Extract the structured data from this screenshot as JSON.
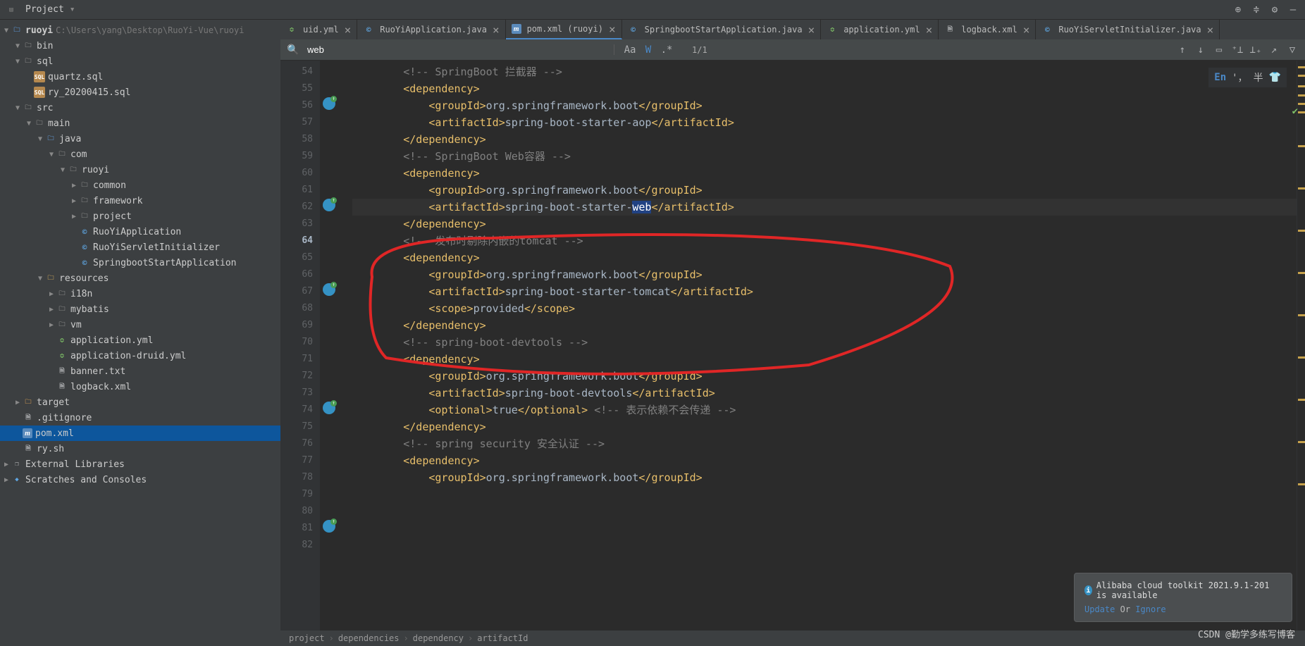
{
  "toolbar": {
    "project_label": "Project"
  },
  "tree": {
    "root": {
      "name": "ruoyi",
      "path": "C:\\Users\\yang\\Desktop\\RuoYi-Vue\\ruoyi"
    },
    "items": [
      {
        "d": 1,
        "tw": "▼",
        "ic": "dir",
        "l": "bin"
      },
      {
        "d": 1,
        "tw": "▼",
        "ic": "dir",
        "l": "sql"
      },
      {
        "d": 2,
        "tw": "",
        "ic": "sql",
        "l": "quartz.sql"
      },
      {
        "d": 2,
        "tw": "",
        "ic": "sql",
        "l": "ry_20200415.sql"
      },
      {
        "d": 1,
        "tw": "▼",
        "ic": "dir",
        "l": "src"
      },
      {
        "d": 2,
        "tw": "▼",
        "ic": "dir",
        "l": "main"
      },
      {
        "d": 3,
        "tw": "▼",
        "ic": "dir-src",
        "l": "java"
      },
      {
        "d": 4,
        "tw": "▼",
        "ic": "dir",
        "l": "com"
      },
      {
        "d": 5,
        "tw": "▼",
        "ic": "dir",
        "l": "ruoyi"
      },
      {
        "d": 6,
        "tw": "▶",
        "ic": "dir",
        "l": "common"
      },
      {
        "d": 6,
        "tw": "▶",
        "ic": "dir",
        "l": "framework"
      },
      {
        "d": 6,
        "tw": "▶",
        "ic": "dir",
        "l": "project"
      },
      {
        "d": 6,
        "tw": "",
        "ic": "java",
        "l": "RuoYiApplication"
      },
      {
        "d": 6,
        "tw": "",
        "ic": "java",
        "l": "RuoYiServletInitializer"
      },
      {
        "d": 6,
        "tw": "",
        "ic": "java",
        "l": "SpringbootStartApplication"
      },
      {
        "d": 3,
        "tw": "▼",
        "ic": "dir-res",
        "l": "resources"
      },
      {
        "d": 4,
        "tw": "▶",
        "ic": "dir",
        "l": "i18n"
      },
      {
        "d": 4,
        "tw": "▶",
        "ic": "dir",
        "l": "mybatis"
      },
      {
        "d": 4,
        "tw": "▶",
        "ic": "dir",
        "l": "vm"
      },
      {
        "d": 4,
        "tw": "",
        "ic": "yml",
        "l": "application.yml"
      },
      {
        "d": 4,
        "tw": "",
        "ic": "yml",
        "l": "application-druid.yml"
      },
      {
        "d": 4,
        "tw": "",
        "ic": "file",
        "l": "banner.txt"
      },
      {
        "d": 4,
        "tw": "",
        "ic": "file",
        "l": "logback.xml"
      },
      {
        "d": 1,
        "tw": "▶",
        "ic": "dir-exc",
        "l": "target"
      },
      {
        "d": 1,
        "tw": "",
        "ic": "file",
        "l": ".gitignore"
      },
      {
        "d": 1,
        "tw": "",
        "ic": "m",
        "l": "pom.xml",
        "sel": true
      },
      {
        "d": 1,
        "tw": "",
        "ic": "file",
        "l": "ry.sh"
      }
    ],
    "ext1": "External Libraries",
    "ext2": "Scratches and Consoles"
  },
  "tabs": [
    {
      "ic": "yml",
      "l": "uid.yml",
      "cut": true
    },
    {
      "ic": "java",
      "l": "RuoYiApplication.java"
    },
    {
      "ic": "m",
      "l": "pom.xml (ruoyi)",
      "active": true
    },
    {
      "ic": "java",
      "l": "SpringbootStartApplication.java"
    },
    {
      "ic": "yml",
      "l": "application.yml"
    },
    {
      "ic": "file",
      "l": "logback.xml"
    },
    {
      "ic": "java",
      "l": "RuoYiServletInitializer.java"
    }
  ],
  "search": {
    "value": "web",
    "count": "1/1",
    "aa": "Aa",
    "w": "W",
    "re": ".*"
  },
  "code": {
    "first_line": 54,
    "lines": [
      {
        "n": 54,
        "t": ""
      },
      {
        "n": 55,
        "t": "        <!-- SpringBoot 拦截器 -->",
        "cls": "com"
      },
      {
        "n": 56,
        "t": "        <dependency>",
        "cls": "tag",
        "mark": true
      },
      {
        "n": 57,
        "t": "            <groupId>org.springframework.boot</groupId>",
        "cls": "tag"
      },
      {
        "n": 58,
        "t": "            <artifactId>spring-boot-starter-aop</artifactId>",
        "cls": "tag"
      },
      {
        "n": 59,
        "t": "        </dependency>",
        "cls": "tag"
      },
      {
        "n": 60,
        "t": ""
      },
      {
        "n": 61,
        "t": "        <!-- SpringBoot Web容器 -->",
        "cls": "com"
      },
      {
        "n": 62,
        "t": "        <dependency>",
        "cls": "tag",
        "mark": true
      },
      {
        "n": 63,
        "t": "            <groupId>org.springframework.boot</groupId>",
        "cls": "tag"
      },
      {
        "n": 64,
        "t": "            <artifactId>spring-boot-starter-",
        "cls": "tag",
        "curr": true,
        "selword": "web",
        "after": "</artifactId>"
      },
      {
        "n": 65,
        "t": "        </dependency>",
        "cls": "tag"
      },
      {
        "n": 66,
        "t": "        <!-- 发布时剔除内嵌的tomcat -->",
        "cls": "com"
      },
      {
        "n": 67,
        "t": "        <dependency>",
        "cls": "tag",
        "mark": true
      },
      {
        "n": 68,
        "t": "            <groupId>org.springframework.boot</groupId>",
        "cls": "tag"
      },
      {
        "n": 69,
        "t": "            <artifactId>spring-boot-starter-tomcat</artifactId>",
        "cls": "tag"
      },
      {
        "n": 70,
        "t": "            <scope>provided</scope>",
        "cls": "tag"
      },
      {
        "n": 71,
        "t": "        </dependency>",
        "cls": "tag"
      },
      {
        "n": 72,
        "t": ""
      },
      {
        "n": 73,
        "t": "        <!-- spring-boot-devtools -->",
        "cls": "com"
      },
      {
        "n": 74,
        "t": "        <dependency>",
        "cls": "tag",
        "mark": true
      },
      {
        "n": 75,
        "t": "            <groupId>org.springframework.boot</groupId>",
        "cls": "tag"
      },
      {
        "n": 76,
        "t": "            <artifactId>spring-boot-devtools</artifactId>",
        "cls": "tag"
      },
      {
        "n": 77,
        "t": "            <optional>true</optional> ",
        "cls": "tag",
        "inline_com": "<!-- 表示依赖不会传递 -->"
      },
      {
        "n": 78,
        "t": "        </dependency>",
        "cls": "tag"
      },
      {
        "n": 79,
        "t": ""
      },
      {
        "n": 80,
        "t": "        <!-- spring security 安全认证 -->",
        "cls": "com"
      },
      {
        "n": 81,
        "t": "        <dependency>",
        "cls": "tag",
        "mark": true
      },
      {
        "n": 82,
        "t": "            <groupId>org.springframework.boot</groupId>",
        "cls": "tag"
      }
    ]
  },
  "breadcrumbs": [
    "project",
    "dependencies",
    "dependency",
    "artifactId"
  ],
  "notice": {
    "title": "Alibaba cloud toolkit 2021.9.1-201 is available",
    "update": "Update",
    "or": "Or",
    "ignore": "Ignore"
  },
  "ime": {
    "en": "En",
    "punct": "'，",
    "half": "半"
  },
  "watermark": "CSDN @勤学多练写博客"
}
